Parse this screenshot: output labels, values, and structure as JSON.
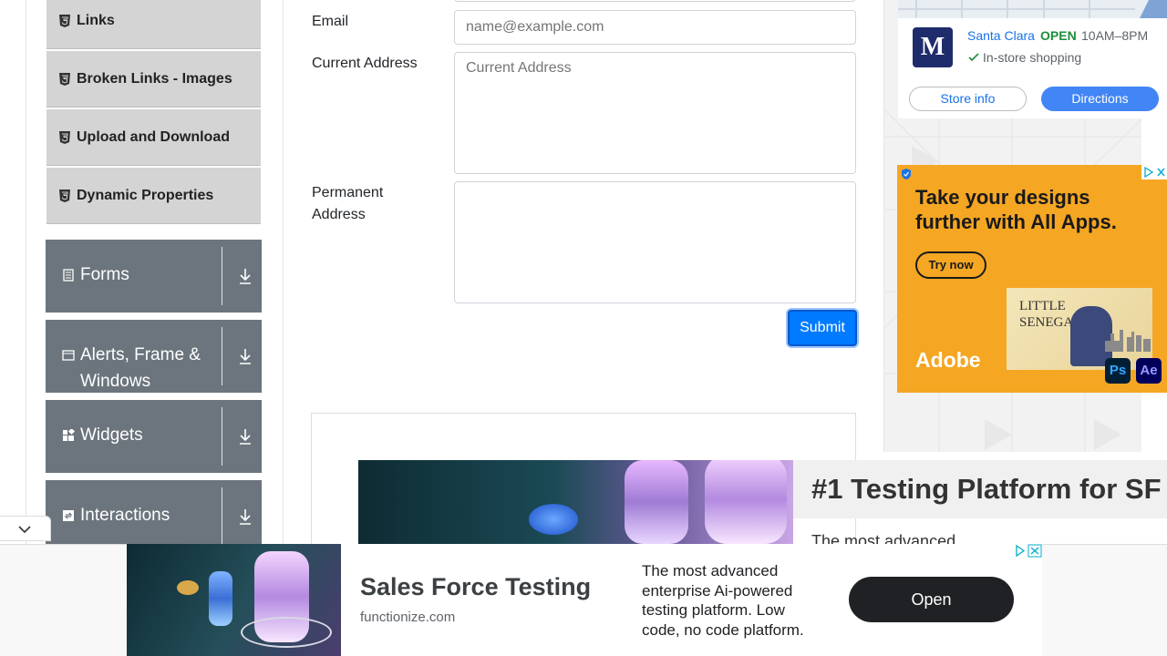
{
  "sidebar": {
    "sub_items": [
      {
        "label": "Links"
      },
      {
        "label": "Broken Links - Images"
      },
      {
        "label": "Upload and Download"
      },
      {
        "label": "Dynamic Properties"
      }
    ],
    "groups": [
      {
        "label": "Forms"
      },
      {
        "label": "Alerts, Frame & Windows"
      },
      {
        "label": "Widgets"
      },
      {
        "label": "Interactions"
      }
    ]
  },
  "form": {
    "email_label": "Email",
    "email_placeholder": "name@example.com",
    "current_address_label": "Current Address",
    "current_address_placeholder": "Current Address",
    "permanent_address_label": "Permanent Address",
    "submit_label": "Submit"
  },
  "store_ad": {
    "logo_letter": "M",
    "city": "Santa Clara",
    "status": "OPEN",
    "hours": "10AM–8PM",
    "feature": "In-store shopping",
    "store_info_label": "Store info",
    "directions_label": "Directions"
  },
  "adobe_ad": {
    "headline": "Take your designs further with All Apps.",
    "cta": "Try now",
    "brand": "Adobe",
    "poster_text_1": "LITTLE",
    "poster_text_2": "SENEGAL",
    "app1": "Ps",
    "app2": "Ae"
  },
  "promo": {
    "title": "#1 Testing Platform for SF",
    "text": "The most advanced"
  },
  "bottom_ad": {
    "title": "Sales Force Testing",
    "domain": "functionize.com",
    "description": "The most advanced enterprise Ai-powered testing platform. Low code, no code platform.",
    "open_label": "Open"
  },
  "colors": {
    "primary": "#007bff",
    "sidebar_group": "#6c757d",
    "sidebar_sub": "#d4d4d4",
    "adobe_orange": "#f5a623",
    "directions_blue": "#4285f4"
  }
}
